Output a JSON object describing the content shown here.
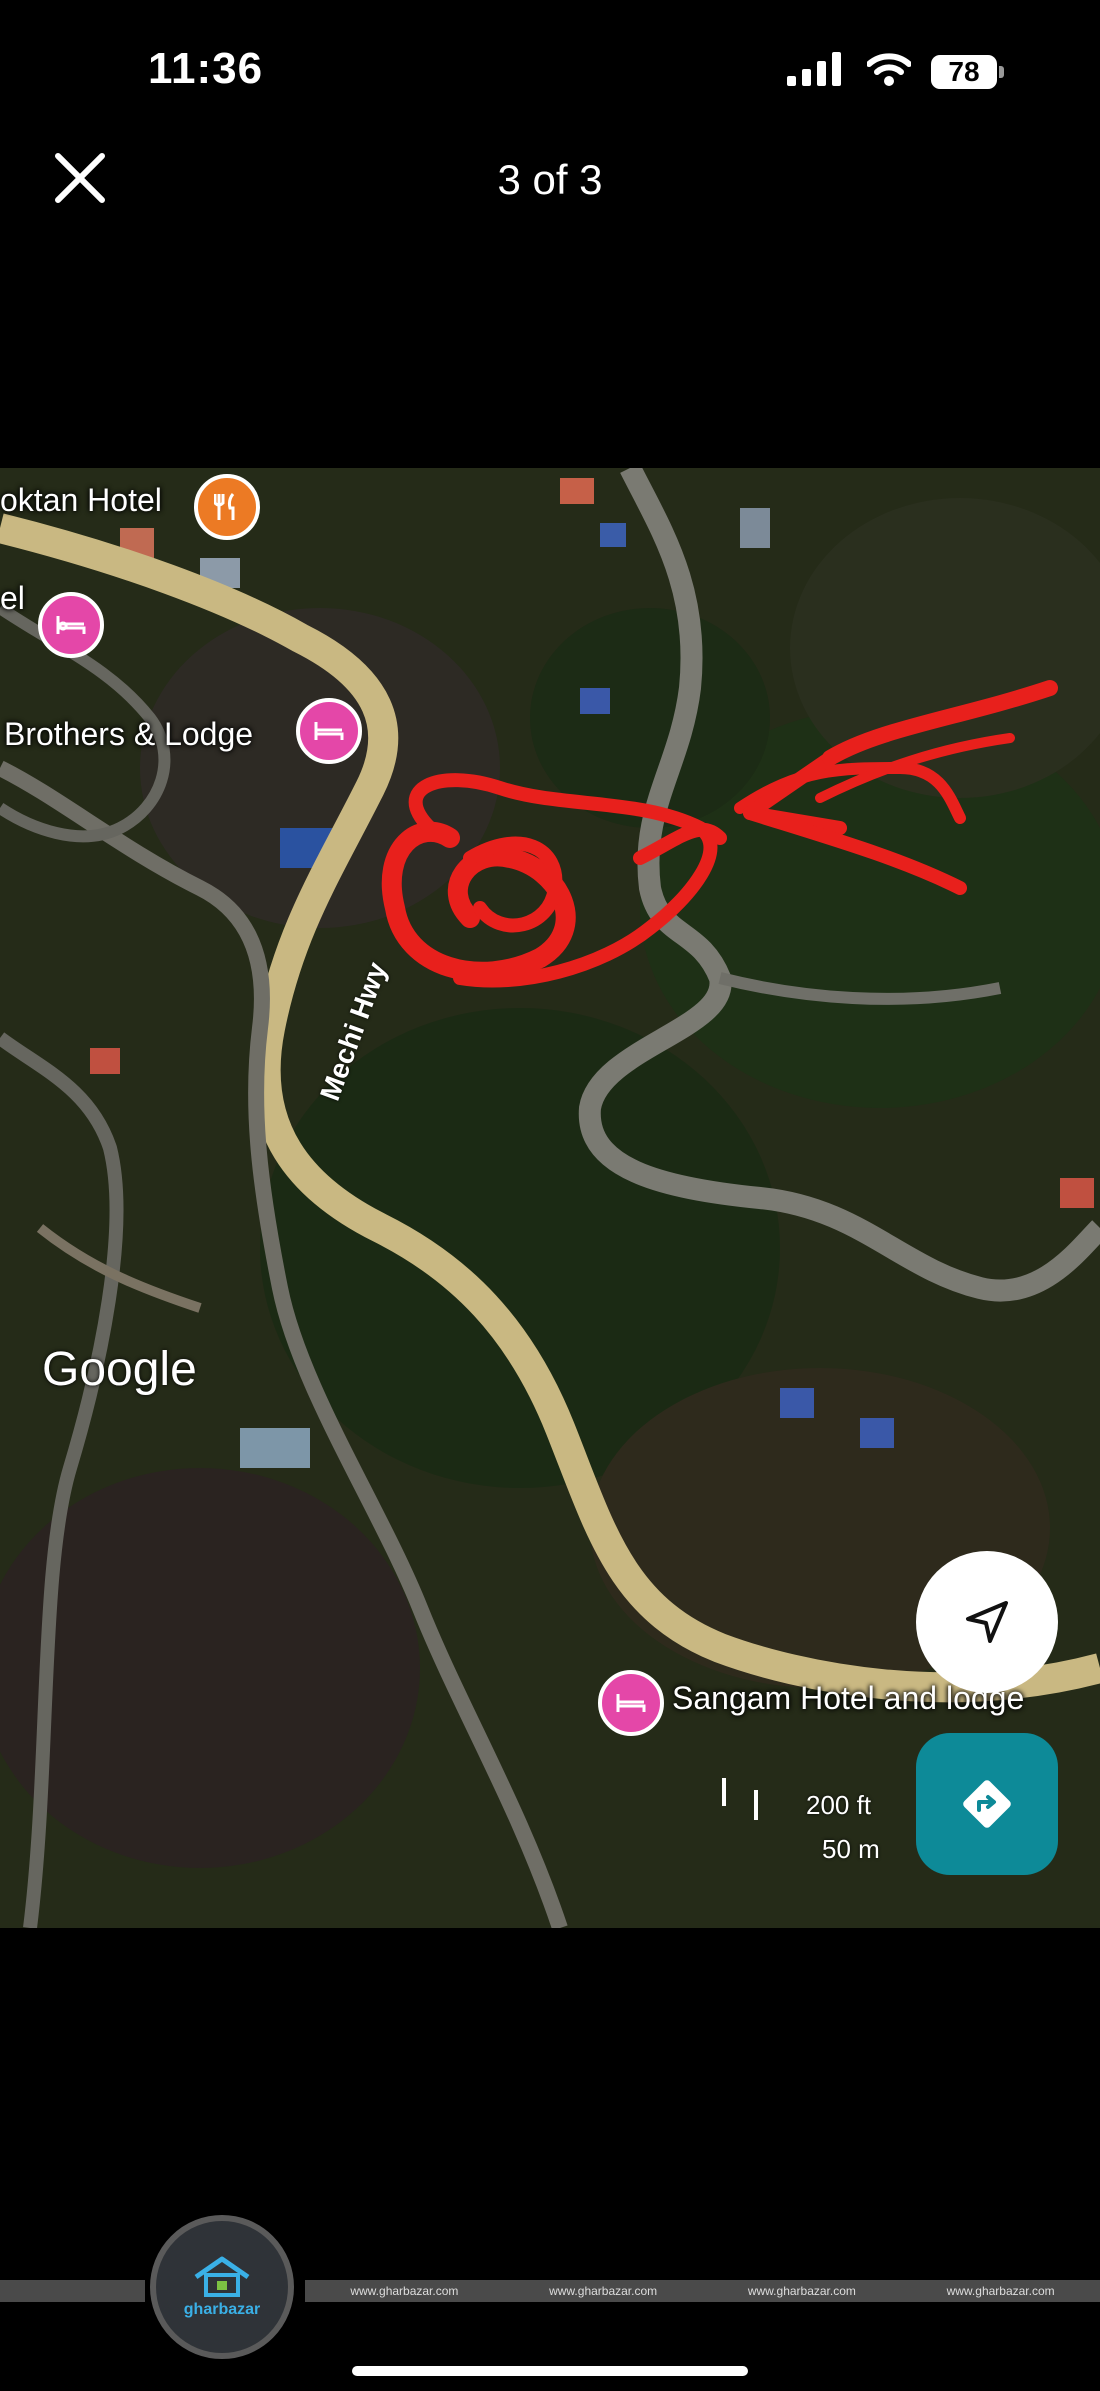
{
  "status_bar": {
    "time": "11:36",
    "battery_level": "78",
    "icons": [
      "signal-icon",
      "wifi-icon",
      "battery-icon"
    ]
  },
  "header": {
    "close_icon": "close-icon",
    "title": "3 of 3"
  },
  "map": {
    "pois": [
      {
        "label": "oktan Hotel",
        "icon": "restaurant-icon",
        "color": "#ec7a24"
      },
      {
        "label": "el",
        "icon": "hotel-icon",
        "color": "#e447a8"
      },
      {
        "label": "Brothers & Lodge",
        "icon": "hotel-icon",
        "color": "#e447a8"
      },
      {
        "label": "Sangam Hotel and lodge",
        "icon": "hotel-icon",
        "color": "#e447a8"
      }
    ],
    "road_label": "Mechi Hwy",
    "attribution": "Google",
    "scale": {
      "imperial": "200 ft",
      "metric": "50 m"
    },
    "compass_icon": "navigation-arrow-icon",
    "directions_icon": "directions-icon",
    "directions_color": "#0d8a98",
    "annotation_color": "#e8201c"
  },
  "watermark": {
    "site": "www.gharbazar.com",
    "brand": "gharbazar"
  }
}
